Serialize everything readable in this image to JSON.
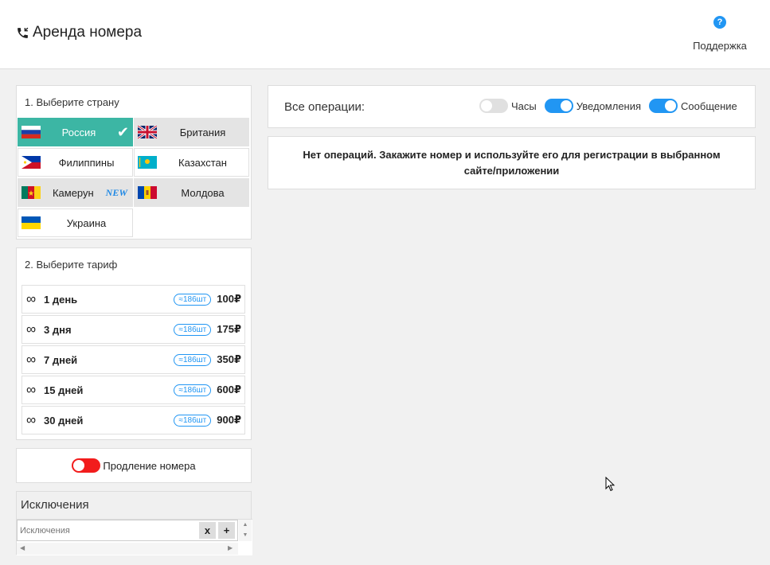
{
  "header": {
    "title": "Аренда номера",
    "support_label": "Поддержка",
    "support_icon": "question-circle-icon",
    "phone_icon": "phone-call-icon"
  },
  "countries": {
    "title": "1. Выберите страну",
    "items": [
      {
        "name": "Россия",
        "flag": "russia-flag",
        "selected": true
      },
      {
        "name": "Британия",
        "flag": "uk-flag"
      },
      {
        "name": "Филиппины",
        "flag": "philippines-flag"
      },
      {
        "name": "Казахстан",
        "flag": "kazakhstan-flag"
      },
      {
        "name": "Камерун",
        "flag": "cameroon-flag",
        "badge": "NEW"
      },
      {
        "name": "Молдова",
        "flag": "moldova-flag"
      },
      {
        "name": "Украина",
        "flag": "ukraine-flag"
      }
    ]
  },
  "tariffs": {
    "title": "2. Выберите тариф",
    "items": [
      {
        "icon": "∞",
        "name": "1 день",
        "stock": "≈186шт",
        "price": "100₽"
      },
      {
        "icon": "∞",
        "name": "3 дня",
        "stock": "≈186шт",
        "price": "175₽"
      },
      {
        "icon": "∞",
        "name": "7 дней",
        "stock": "≈186шт",
        "price": "350₽"
      },
      {
        "icon": "∞",
        "name": "15 дней",
        "stock": "≈186шт",
        "price": "600₽"
      },
      {
        "icon": "∞",
        "name": "30 дней",
        "stock": "≈186шт",
        "price": "900₽"
      }
    ]
  },
  "renewal": {
    "label": "Продление номера",
    "enabled": false,
    "color": "#f21c1c"
  },
  "exclusions": {
    "title": "Исключения",
    "placeholder": "Исключения",
    "clear_label": "x",
    "add_label": "+"
  },
  "operations": {
    "label": "Все операции:",
    "toggles": [
      {
        "label": "Часы",
        "on": false
      },
      {
        "label": "Уведомления",
        "on": true
      },
      {
        "label": "Сообщение",
        "on": true
      }
    ],
    "empty_message": "Нет операций. Закажите номер и используйте его для регистрации в выбранном сайте/приложении"
  },
  "colors": {
    "accent": "#2196f3",
    "selected": "#3cb6a4",
    "badge_new": "#1e88e5"
  }
}
